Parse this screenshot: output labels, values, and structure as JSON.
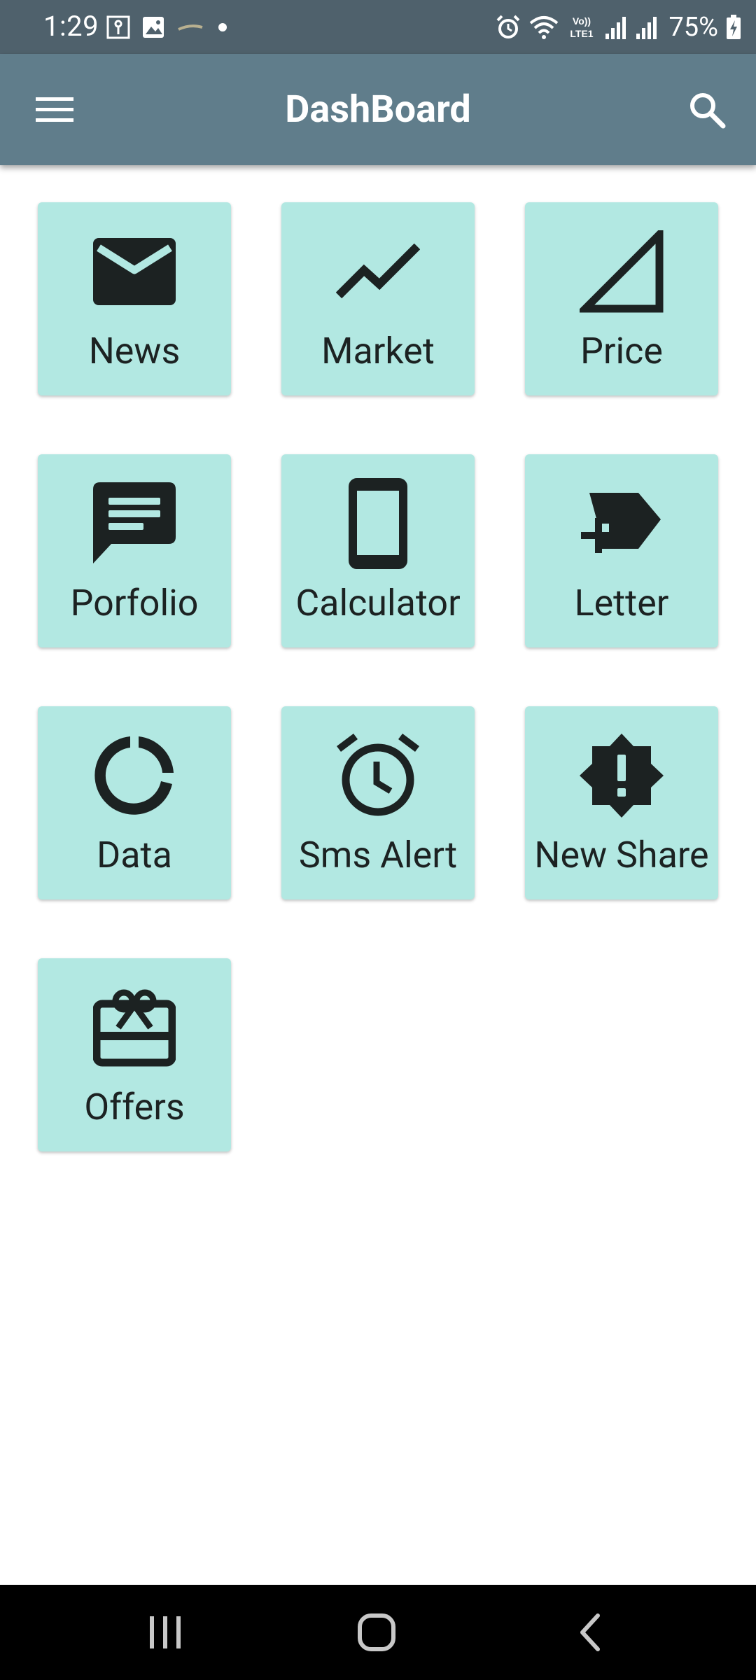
{
  "status_bar": {
    "time": "1:29",
    "battery_percent": "75%",
    "icons": [
      "key-notification-icon",
      "gallery-notification-icon",
      "app-notification-icon",
      "dot-icon",
      "alarm-icon",
      "wifi-icon",
      "volte-lte-icon",
      "signal-icon",
      "signal-icon-2",
      "battery-charging-icon"
    ]
  },
  "app_bar": {
    "title": "DashBoard",
    "menu_icon": "menu-icon",
    "search_icon": "search-icon",
    "background_color": "#607d8b"
  },
  "tiles": [
    {
      "label": "News",
      "icon": "email-icon"
    },
    {
      "label": "Market",
      "icon": "trending-line-icon"
    },
    {
      "label": "Price",
      "icon": "triangle-icon"
    },
    {
      "label": "Porfolio",
      "icon": "message-icon"
    },
    {
      "label": "Calculator",
      "icon": "phone-icon"
    },
    {
      "label": "Letter",
      "icon": "label-add-icon"
    },
    {
      "label": "Data",
      "icon": "donut-icon"
    },
    {
      "label": "Sms Alert",
      "icon": "alarm-clock-icon"
    },
    {
      "label": "New Share",
      "icon": "alert-badge-icon"
    },
    {
      "label": "Offers",
      "icon": "gift-card-icon"
    }
  ],
  "colors": {
    "tile_background": "#b2e8e2",
    "icon_color": "#1c2222",
    "status_bar": "#4f616c"
  },
  "nav_bar": {
    "recents_icon": "recents-icon",
    "home_icon": "home-icon",
    "back_icon": "back-icon"
  }
}
